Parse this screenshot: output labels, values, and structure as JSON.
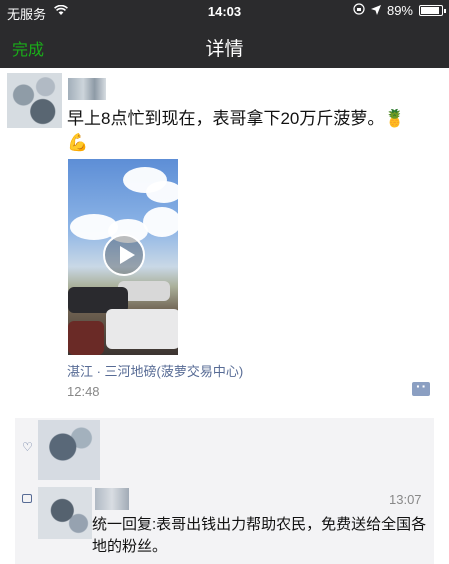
{
  "status_bar": {
    "carrier": "无服务",
    "time": "14:03",
    "battery": "89%",
    "battery_level": 0.89
  },
  "nav": {
    "done_label": "完成",
    "title": "详情"
  },
  "post": {
    "text": "早上8点忙到现在，表哥拿下20万斤菠萝。",
    "emojis": [
      "🍍",
      "💪"
    ],
    "location": "湛江 · 三河地磅(菠萝交易中心)",
    "time": "12:48"
  },
  "comment": {
    "time": "13:07",
    "text": "统一回复:表哥出钱出力帮助农民，免费送给全国各地的粉丝。"
  },
  "icons": {
    "wifi": "wifi-icon",
    "location": "location-arrow-icon",
    "lock": "rotation-lock-icon",
    "play": "play-icon",
    "comment_button": "comment-more-icon",
    "like": "heart-icon",
    "comment": "comment-icon"
  },
  "colors": {
    "nav_bg": "#2b2b2d",
    "accent_green": "#1aad19",
    "link_blue": "#576b95"
  }
}
